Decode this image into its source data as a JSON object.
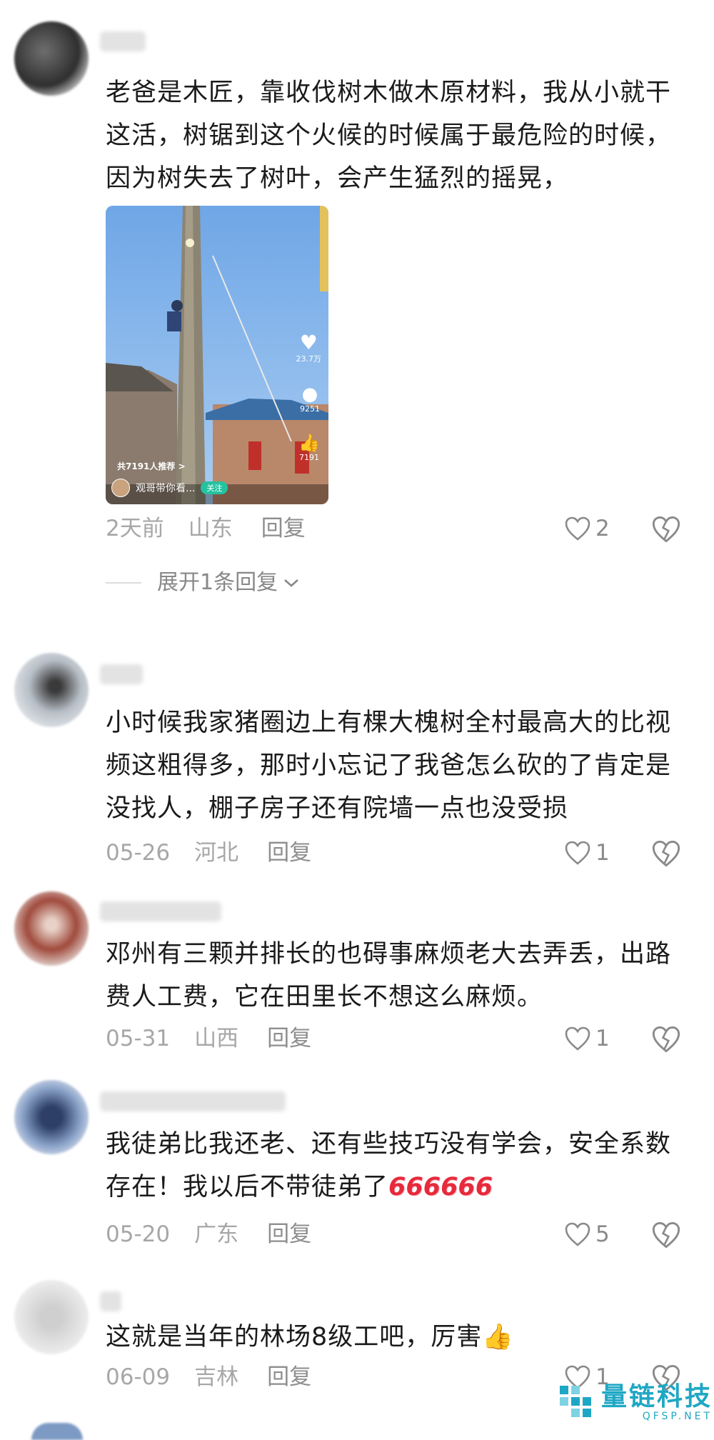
{
  "comments": [
    {
      "text": "老爸是木匠，靠收伐树木做木原材料，我从小就干这活，树锯到这个火候的时候属于最危险的时候，因为树失去了树叶，会产生猛烈的摇晃，",
      "time": "2天前",
      "location": "山东",
      "reply": "回复",
      "likes": "2",
      "media": {
        "stats": [
          "23.7万",
          "9251",
          "7191"
        ],
        "recommend": "共7191人推荐 >",
        "author": "观哥带你看...",
        "follow": "关注"
      },
      "expand_label": "展开1条回复"
    },
    {
      "text": "小时候我家猪圈边上有棵大槐树全村最高大的比视频这粗得多，那时小忘记了我爸怎么砍的了肯定是没找人，棚子房子还有院墙一点也没受损",
      "time": "05-26",
      "location": "河北",
      "reply": "回复",
      "likes": "1"
    },
    {
      "text": "邓州有三颗并排长的也碍事麻烦老大去弄丢，出路费人工费，它在田里长不想这么麻烦。",
      "time": "05-31",
      "location": "山西",
      "reply": "回复",
      "likes": "1"
    },
    {
      "text": "我徒弟比我还老、还有些技巧没有学会，安全系数存在！我以后不带徒弟了",
      "emoji": "666666",
      "time": "05-20",
      "location": "广东",
      "reply": "回复",
      "likes": "5"
    },
    {
      "text": "这就是当年的林场8级工吧，厉害",
      "emoji": "👍",
      "time": "06-09",
      "location": "吉林",
      "reply": "回复",
      "likes": "1"
    }
  ],
  "watermark": {
    "name": "量链科技",
    "sub": "QFSP.NET"
  },
  "colors": {
    "accent": "#1ea7c4",
    "emoji666": "#e62a3c",
    "meta": "#a7a7a7"
  }
}
